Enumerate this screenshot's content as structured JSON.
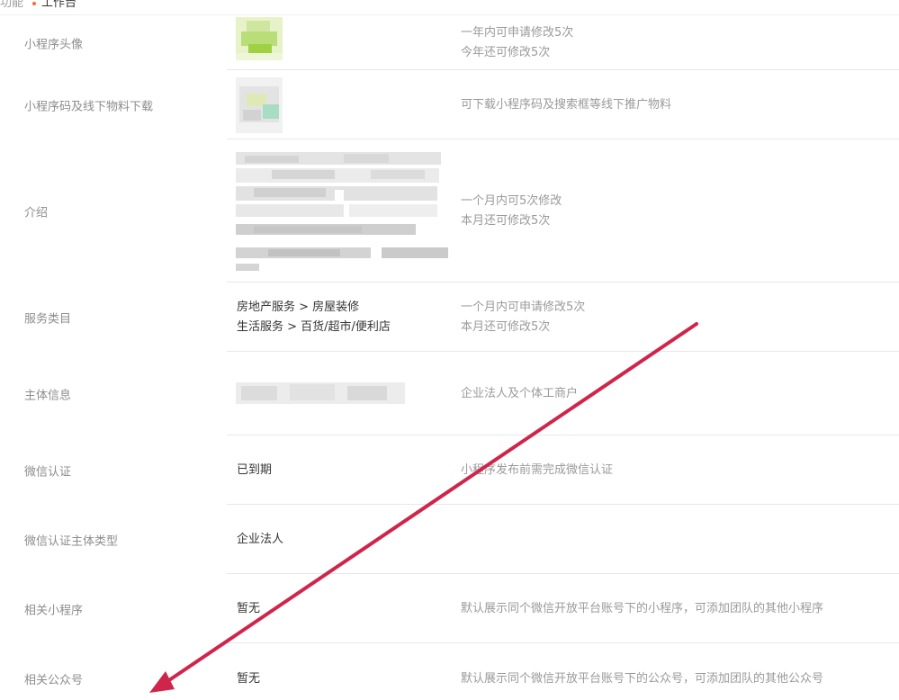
{
  "topbar": {
    "fragment": "功能",
    "tab_label": "工作台"
  },
  "rows": [
    {
      "label": "小程序头像",
      "notes": [
        "一年内可申请修改5次",
        "今年还可修改5次"
      ]
    },
    {
      "label": "小程序码及线下物料下载",
      "notes": [
        "可下载小程序码及搜索框等线下推广物料"
      ]
    },
    {
      "label": "介绍",
      "notes": [
        "一个月内可5次修改",
        "本月还可修改5次"
      ]
    },
    {
      "label": "服务类目",
      "values": [
        "房地产服务 > 房屋装修",
        "生活服务 > 百货/超市/便利店"
      ],
      "notes": [
        "一个月内可申请修改5次",
        "本月还可修改5次"
      ]
    },
    {
      "label": "主体信息",
      "notes": [
        "企业法人及个体工商户"
      ]
    },
    {
      "label": "微信认证",
      "values": [
        "已到期"
      ],
      "notes": [
        "小程序发布前需完成微信认证"
      ]
    },
    {
      "label": "微信认证主体类型",
      "values": [
        "企业法人"
      ]
    },
    {
      "label": "相关小程序",
      "values": [
        "暂无"
      ],
      "notes": [
        "默认展示同个微信开放平台账号下的小程序，可添加团队的其他小程序"
      ]
    },
    {
      "label": "相关公众号",
      "values": [
        "暂无"
      ],
      "notes": [
        "默认展示同个微信开放平台账号下的公众号，可添加团队的其他公众号"
      ]
    }
  ],
  "colors": {
    "label": "#8d8d8d",
    "value": "#353535",
    "note": "#9a9a9a",
    "divider": "#e7e7e7",
    "annotation_arrow": "#d0254a",
    "tab_dot": "#fa6a32"
  },
  "icons": {
    "annotation": "red-arrow-annotation",
    "avatar": "pixelated-avatar-image",
    "qrcode": "pixelated-qrcode-image",
    "intro": "pixelated-intro-text",
    "subject": "pixelated-subject-info"
  }
}
